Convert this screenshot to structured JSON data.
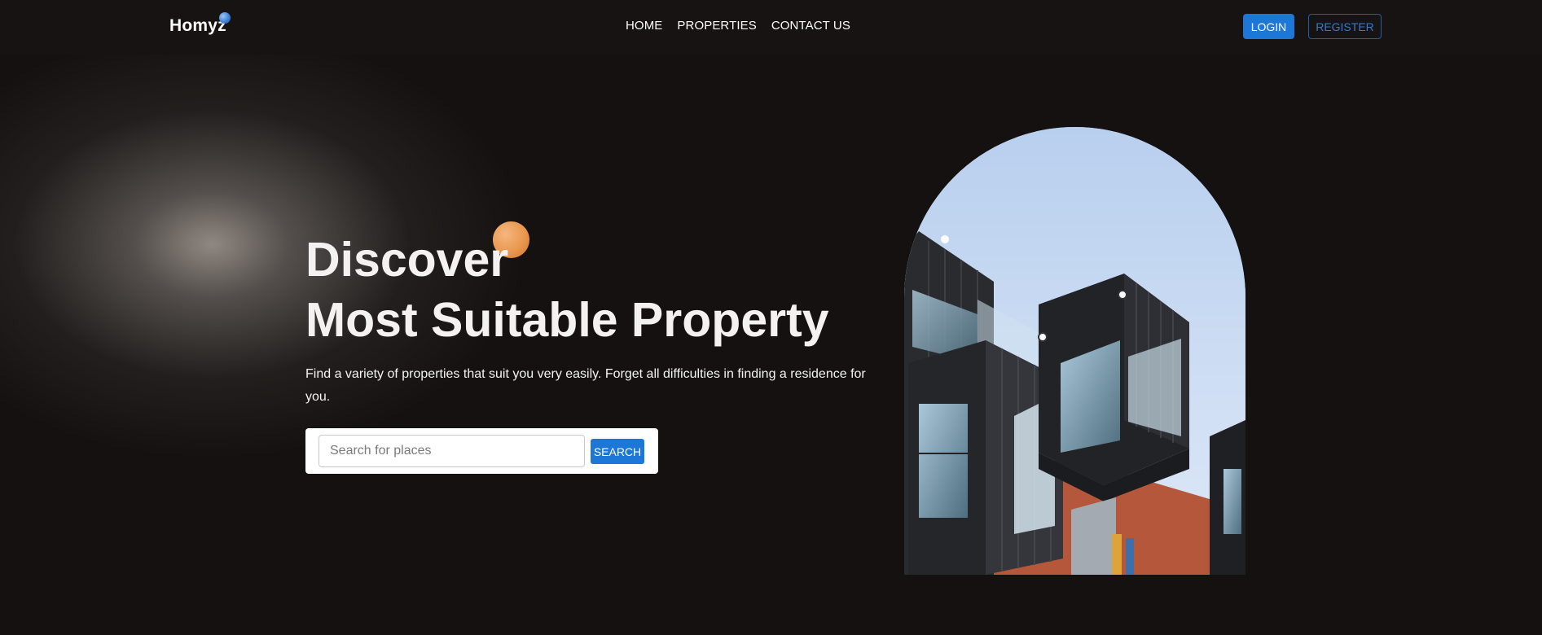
{
  "brand": {
    "name": "Homyz"
  },
  "nav": {
    "links": [
      {
        "label": "HOME"
      },
      {
        "label": "PROPERTIES"
      },
      {
        "label": "CONTACT US"
      }
    ],
    "login_label": "LOGIN",
    "register_label": "REGISTER"
  },
  "hero": {
    "title_line1": "Discover",
    "title_line2": "Most Suitable Property",
    "subtitle": "Find a variety of properties that suit you very easily. Forget all difficulties in finding a residence for you.",
    "search": {
      "placeholder": "Search for places",
      "button_label": "SEARCH"
    },
    "image_icon": "building-photo"
  },
  "colors": {
    "background": "#141110",
    "accent_blue": "#1d77d6",
    "accent_orange": "#e8954a"
  }
}
